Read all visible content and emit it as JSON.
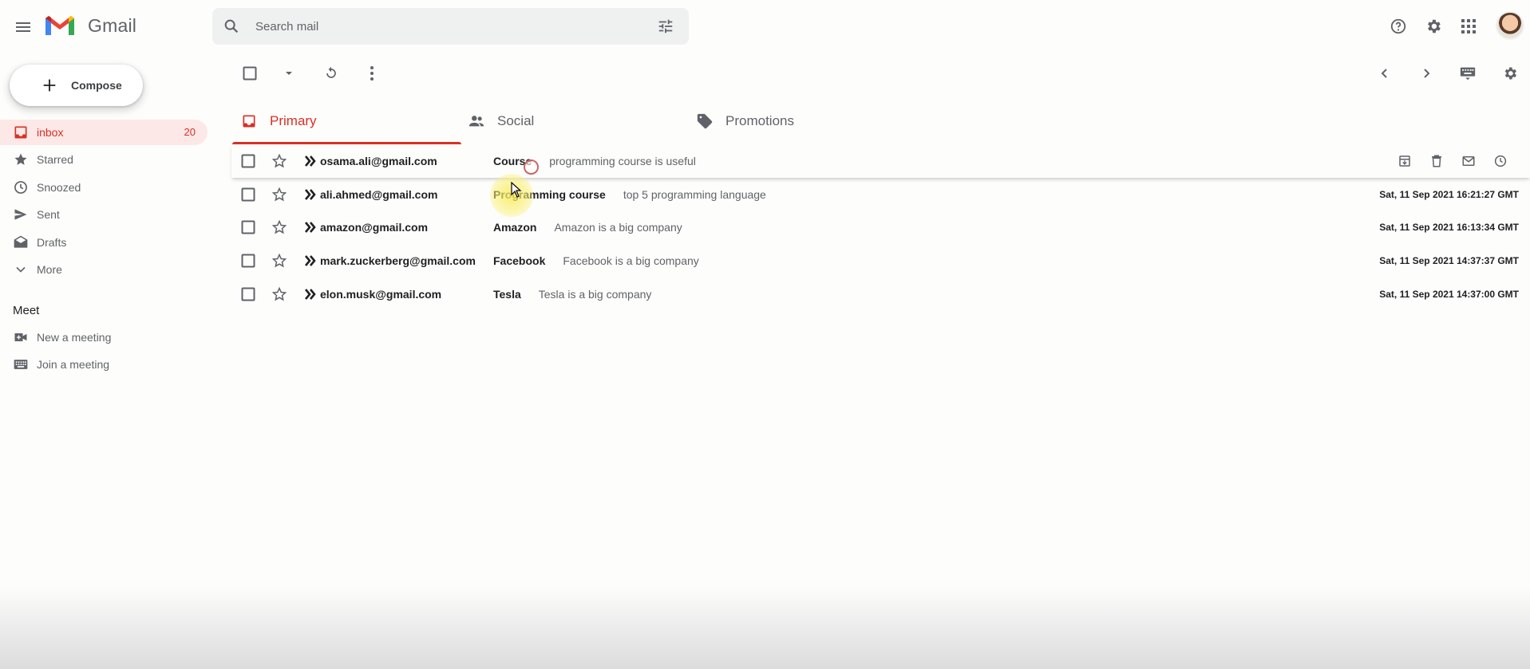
{
  "header": {
    "brand": "Gmail",
    "search_placeholder": "Search mail"
  },
  "compose": {
    "label": "Compose"
  },
  "sidebar": {
    "items": [
      {
        "label": "inbox",
        "count": "20",
        "icon": "inbox-icon",
        "active": true
      },
      {
        "label": "Starred",
        "icon": "star-icon"
      },
      {
        "label": "Snoozed",
        "icon": "clock-icon"
      },
      {
        "label": "Sent",
        "icon": "send-icon"
      },
      {
        "label": "Drafts",
        "icon": "drafts-icon"
      },
      {
        "label": "More",
        "icon": "chevron-down-icon"
      }
    ],
    "meet": {
      "title": "Meet",
      "items": [
        {
          "label": "New a meeting",
          "icon": "videocam-icon"
        },
        {
          "label": "Join a meeting",
          "icon": "keyboard-icon"
        }
      ]
    }
  },
  "tabs": [
    {
      "label": "Primary",
      "icon": "inbox-icon",
      "active": true
    },
    {
      "label": "Social",
      "icon": "people-icon"
    },
    {
      "label": "Promotions",
      "icon": "tag-icon"
    }
  ],
  "emails": [
    {
      "sender": "osama.ali@gmail.com",
      "subject": "Course",
      "snippet": "programming course is useful",
      "date": ""
    },
    {
      "sender": "ali.ahmed@gmail.com",
      "subject": "Programming course",
      "snippet": "top 5 programming language",
      "date": "Sat, 11 Sep 2021 16:21:27 GMT"
    },
    {
      "sender": "amazon@gmail.com",
      "subject": "Amazon",
      "snippet": "Amazon is a big company",
      "date": "Sat, 11 Sep 2021 16:13:34 GMT"
    },
    {
      "sender": "mark.zuckerberg@gmail.com",
      "subject": "Facebook",
      "snippet": "Facebook is a big company",
      "date": "Sat, 11 Sep 2021 14:37:37 GMT"
    },
    {
      "sender": "elon.musk@gmail.com",
      "subject": "Tesla",
      "snippet": "Tesla is a big company",
      "date": "Sat, 11 Sep 2021 14:37:00 GMT"
    }
  ],
  "colors": {
    "accent": "#d93025",
    "active_bg": "#fce8e6",
    "search_bg": "#eff1f1",
    "icon_gray": "#5f6368"
  }
}
